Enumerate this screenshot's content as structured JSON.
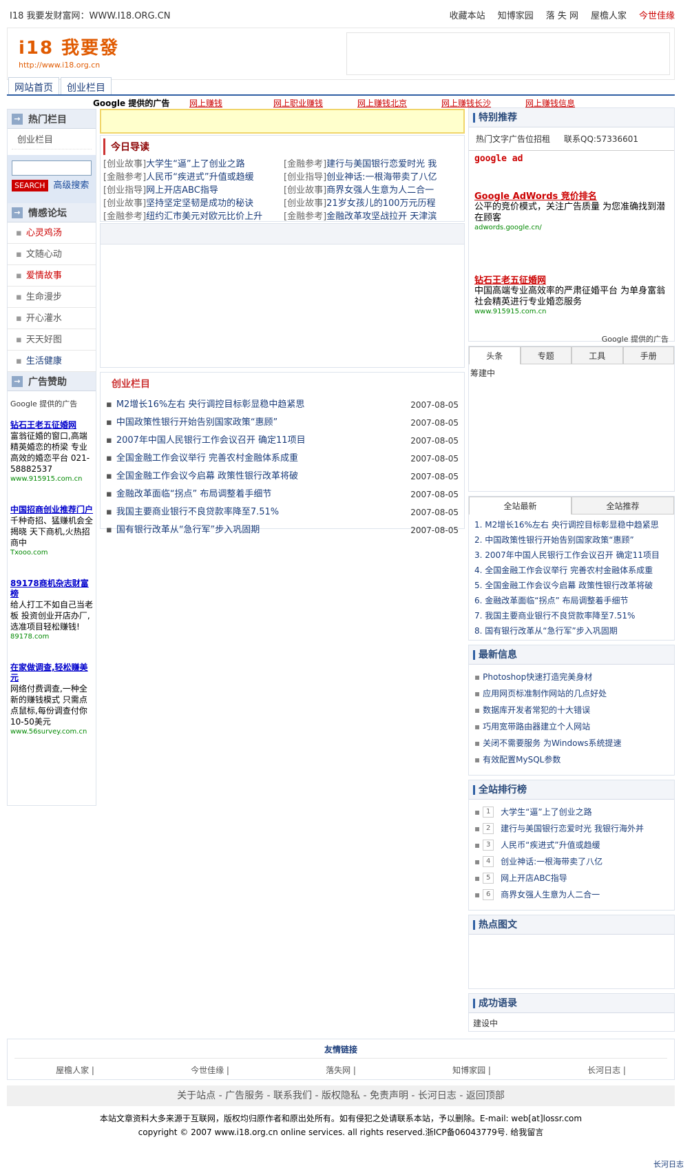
{
  "topbar": {
    "site": "I18 我要发财富网：WWW.I18.ORG.CN",
    "links": [
      "收藏本站",
      "知博家园",
      "落 失 网",
      "屋檐人家",
      "今世佳缘"
    ]
  },
  "logo": {
    "title": "i18 我要發",
    "url": "http://www.i18.org.cn"
  },
  "nav": {
    "tabs": [
      "网站首页",
      "创业栏目"
    ]
  },
  "adrow": {
    "label": "Google 提供的广告",
    "ads": [
      "网上赚钱",
      "网上职业赚钱",
      "网上赚钱北京",
      "网上赚钱长沙",
      "网上赚钱信息"
    ]
  },
  "left": {
    "hot_title": "热门栏目",
    "hot_items": [
      "创业栏目"
    ],
    "search_button": "SEARCH",
    "advanced_search": "高级搜索",
    "emotion_title": "情感论坛",
    "emotion_items": [
      "心灵鸡汤",
      "文随心动",
      "爱情故事",
      "生命漫步",
      "开心灌水",
      "天天好图",
      "生活健康"
    ],
    "emotion_colors": [
      "#c00",
      "#555",
      "#c00",
      "#555",
      "#555",
      "#555",
      "#1a3c7a"
    ],
    "ad_title": "广告赞助",
    "google_label": "Google 提供的广告",
    "ads": [
      {
        "title": "钻石王老五征婚网",
        "desc": "富翁征婚的窗口,高端精英婚恋的桥梁 专业高效的婚恋平台 021-58882537",
        "url": "www.915915.com.cn"
      },
      {
        "title": "中国招商创业推荐门户",
        "desc": "千种奇招、猛赚机会全揭晓 天下商机,火热招商中",
        "url": "Txooo.com"
      },
      {
        "title": "89178商机杂志财富榜",
        "desc": "给人打工不如自己当老板 投资创业开店办厂,选准项目轻松赚钱!",
        "url": "89178.com"
      },
      {
        "title": "在家做调查,轻松赚美元",
        "desc": "网络付费调查,一种全新的赚钱模式 只需点点鼠标,每份调查付你10-50美元",
        "url": "www.56survey.com.cn"
      }
    ]
  },
  "today": {
    "title": "今日导读",
    "items": [
      {
        "cat": "[创业故事]",
        "txt": "大学生“逼”上了创业之路"
      },
      {
        "cat": "[金融参考]",
        "txt": "建行与美国银行恋爱时光 我"
      },
      {
        "cat": "[金融参考]",
        "txt": "人民币“疾进式”升值或趋缓"
      },
      {
        "cat": "[创业指导]",
        "txt": "创业神话:一根海带卖了八亿"
      },
      {
        "cat": "[创业指导]",
        "txt": "网上开店ABC指导"
      },
      {
        "cat": "[创业故事]",
        "txt": "商界女强人生意为人二合一"
      },
      {
        "cat": "[创业故事]",
        "txt": "坚持坚定坚韧是成功的秘诀"
      },
      {
        "cat": "[创业故事]",
        "txt": "21岁女孩儿的100万元历程"
      },
      {
        "cat": "[金融参考]",
        "txt": "纽约汇市美元对欧元比价上升"
      },
      {
        "cat": "[金融参考]",
        "txt": "金融改革攻坚战拉开 天津滨"
      }
    ]
  },
  "cyan": {
    "title": "创业栏目",
    "items": [
      {
        "t": "M2增长16%左右 央行调控目标彰显稳中趋紧思",
        "d": "2007-08-05"
      },
      {
        "t": "中国政策性银行开始告别国家政策“惠顾”",
        "d": "2007-08-05"
      },
      {
        "t": "2007年中国人民银行工作会议召开 确定11项目",
        "d": "2007-08-05"
      },
      {
        "t": "全国金融工作会议举行 完善农村金融体系成重",
        "d": "2007-08-05"
      },
      {
        "t": "全国金融工作会议今启幕 政策性银行改革将破",
        "d": "2007-08-05"
      },
      {
        "t": "金融改革面临“拐点” 布局调整着手细节",
        "d": "2007-08-05"
      },
      {
        "t": "我国主要商业银行不良贷款率降至7.51%",
        "d": "2007-08-05"
      },
      {
        "t": "国有银行改革从“急行军”步入巩固期",
        "d": "2007-08-05"
      }
    ]
  },
  "right": {
    "special_title": "特别推荐",
    "special_left": "热门文字广告位招租",
    "special_right": "联系QQ:57336601",
    "gad": "google ad",
    "ad1": {
      "title": "Google AdWords 竞价排名",
      "desc": "公平的竞价模式，关注广告质量 为您准确找到潜在顾客",
      "url": "adwords.google.cn/"
    },
    "ad2": {
      "title": "钻石王老五征婚网",
      "desc": "中国高端专业高效率的严肃征婚平台 为单身富翁社会精英进行专业婚恋服务",
      "url": "www.915915.com.cn"
    },
    "google_foot": "Google 提供的广告",
    "tabs": [
      "头条",
      "专题",
      "工具",
      "手册"
    ],
    "tab_content": "筹建中",
    "tabs2": [
      "全站最新",
      "全站推荐"
    ],
    "latest": [
      "1. M2增长16%左右 央行调控目标彰显稳中趋紧思",
      "2. 中国政策性银行开始告别国家政策“惠顾”",
      "3. 2007年中国人民银行工作会议召开 确定11项目",
      "4. 全国金融工作会议举行 完善农村金融体系成重",
      "5. 全国金融工作会议今启幕 政策性银行改革将破",
      "6. 金融改革面临“拐点” 布局调整着手细节",
      "7. 我国主要商业银行不良贷款率降至7.51%",
      "8. 国有银行改革从“急行军”步入巩固期"
    ],
    "news_title": "最新信息",
    "news": [
      "Photoshop快速打造完美身材",
      "应用网页标准制作网站的几点好处",
      "数据库开发者常犯的十大错误",
      "巧用宽带路由器建立个人网站",
      "关闭不需要服务 为Windows系统提速",
      "有效配置MySQL参数"
    ],
    "rank_title": "全站排行榜",
    "rank": [
      "大学生“逼”上了创业之路",
      "建行与美国银行恋爱时光 我银行海外并",
      "人民币“疾进式”升值或趋缓",
      "创业神话:一根海带卖了八亿",
      "网上开店ABC指导",
      "商界女强人生意为人二合一"
    ],
    "hotpic_title": "热点图文",
    "success_title": "成功语录",
    "success_text": "建设中"
  },
  "footer": {
    "friend_title": "友情链接",
    "friends": [
      "屋檐人家 |",
      "今世佳缘 |",
      "落失网 |",
      "知博家园 |",
      "长河日志 |"
    ],
    "nav": "关于站点 - 广告服务 - 联系我们 - 版权隐私 - 免责声明 - 长河日志 - 返回顶部",
    "copy1": "本站文章资料大多来源于互联网，版权均归原作者和原出处所有。如有侵犯之处请联系本站，予以删除。E-mail: web[at]lossr.com",
    "copy2": "copyright © 2007 www.i18.org.cn online services. all rights reserved.浙ICP备06043779号. 给我留言",
    "corner": "长河日志"
  }
}
